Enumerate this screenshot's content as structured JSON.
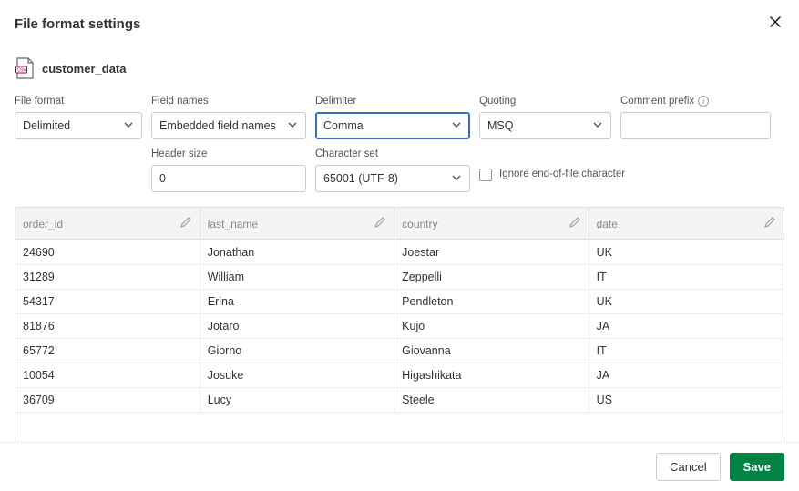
{
  "header": {
    "title": "File format settings"
  },
  "file": {
    "name": "customer_data"
  },
  "labels": {
    "file_format": "File format",
    "field_names": "Field names",
    "delimiter": "Delimiter",
    "quoting": "Quoting",
    "comment_prefix": "Comment prefix",
    "header_size": "Header size",
    "character_set": "Character set",
    "ignore_eof": "Ignore end-of-file character"
  },
  "values": {
    "file_format": "Delimited",
    "field_names": "Embedded field names",
    "delimiter": "Comma",
    "quoting": "MSQ",
    "comment_prefix": "",
    "header_size": "0",
    "character_set": "65001 (UTF-8)"
  },
  "table": {
    "columns": [
      "order_id",
      "last_name",
      "country",
      "date"
    ],
    "rows": [
      [
        "24690",
        "Jonathan",
        "Joestar",
        "UK"
      ],
      [
        "31289",
        "William",
        "Zeppelli",
        "IT"
      ],
      [
        "54317",
        "Erina",
        "Pendleton",
        "UK"
      ],
      [
        "81876",
        "Jotaro",
        "Kujo",
        "JA"
      ],
      [
        "65772",
        "Giorno",
        "Giovanna",
        "IT"
      ],
      [
        "10054",
        "Josuke",
        "Higashikata",
        "JA"
      ],
      [
        "36709",
        "Lucy",
        "Steele",
        "US"
      ]
    ]
  },
  "footer": {
    "cancel": "Cancel",
    "save": "Save"
  }
}
